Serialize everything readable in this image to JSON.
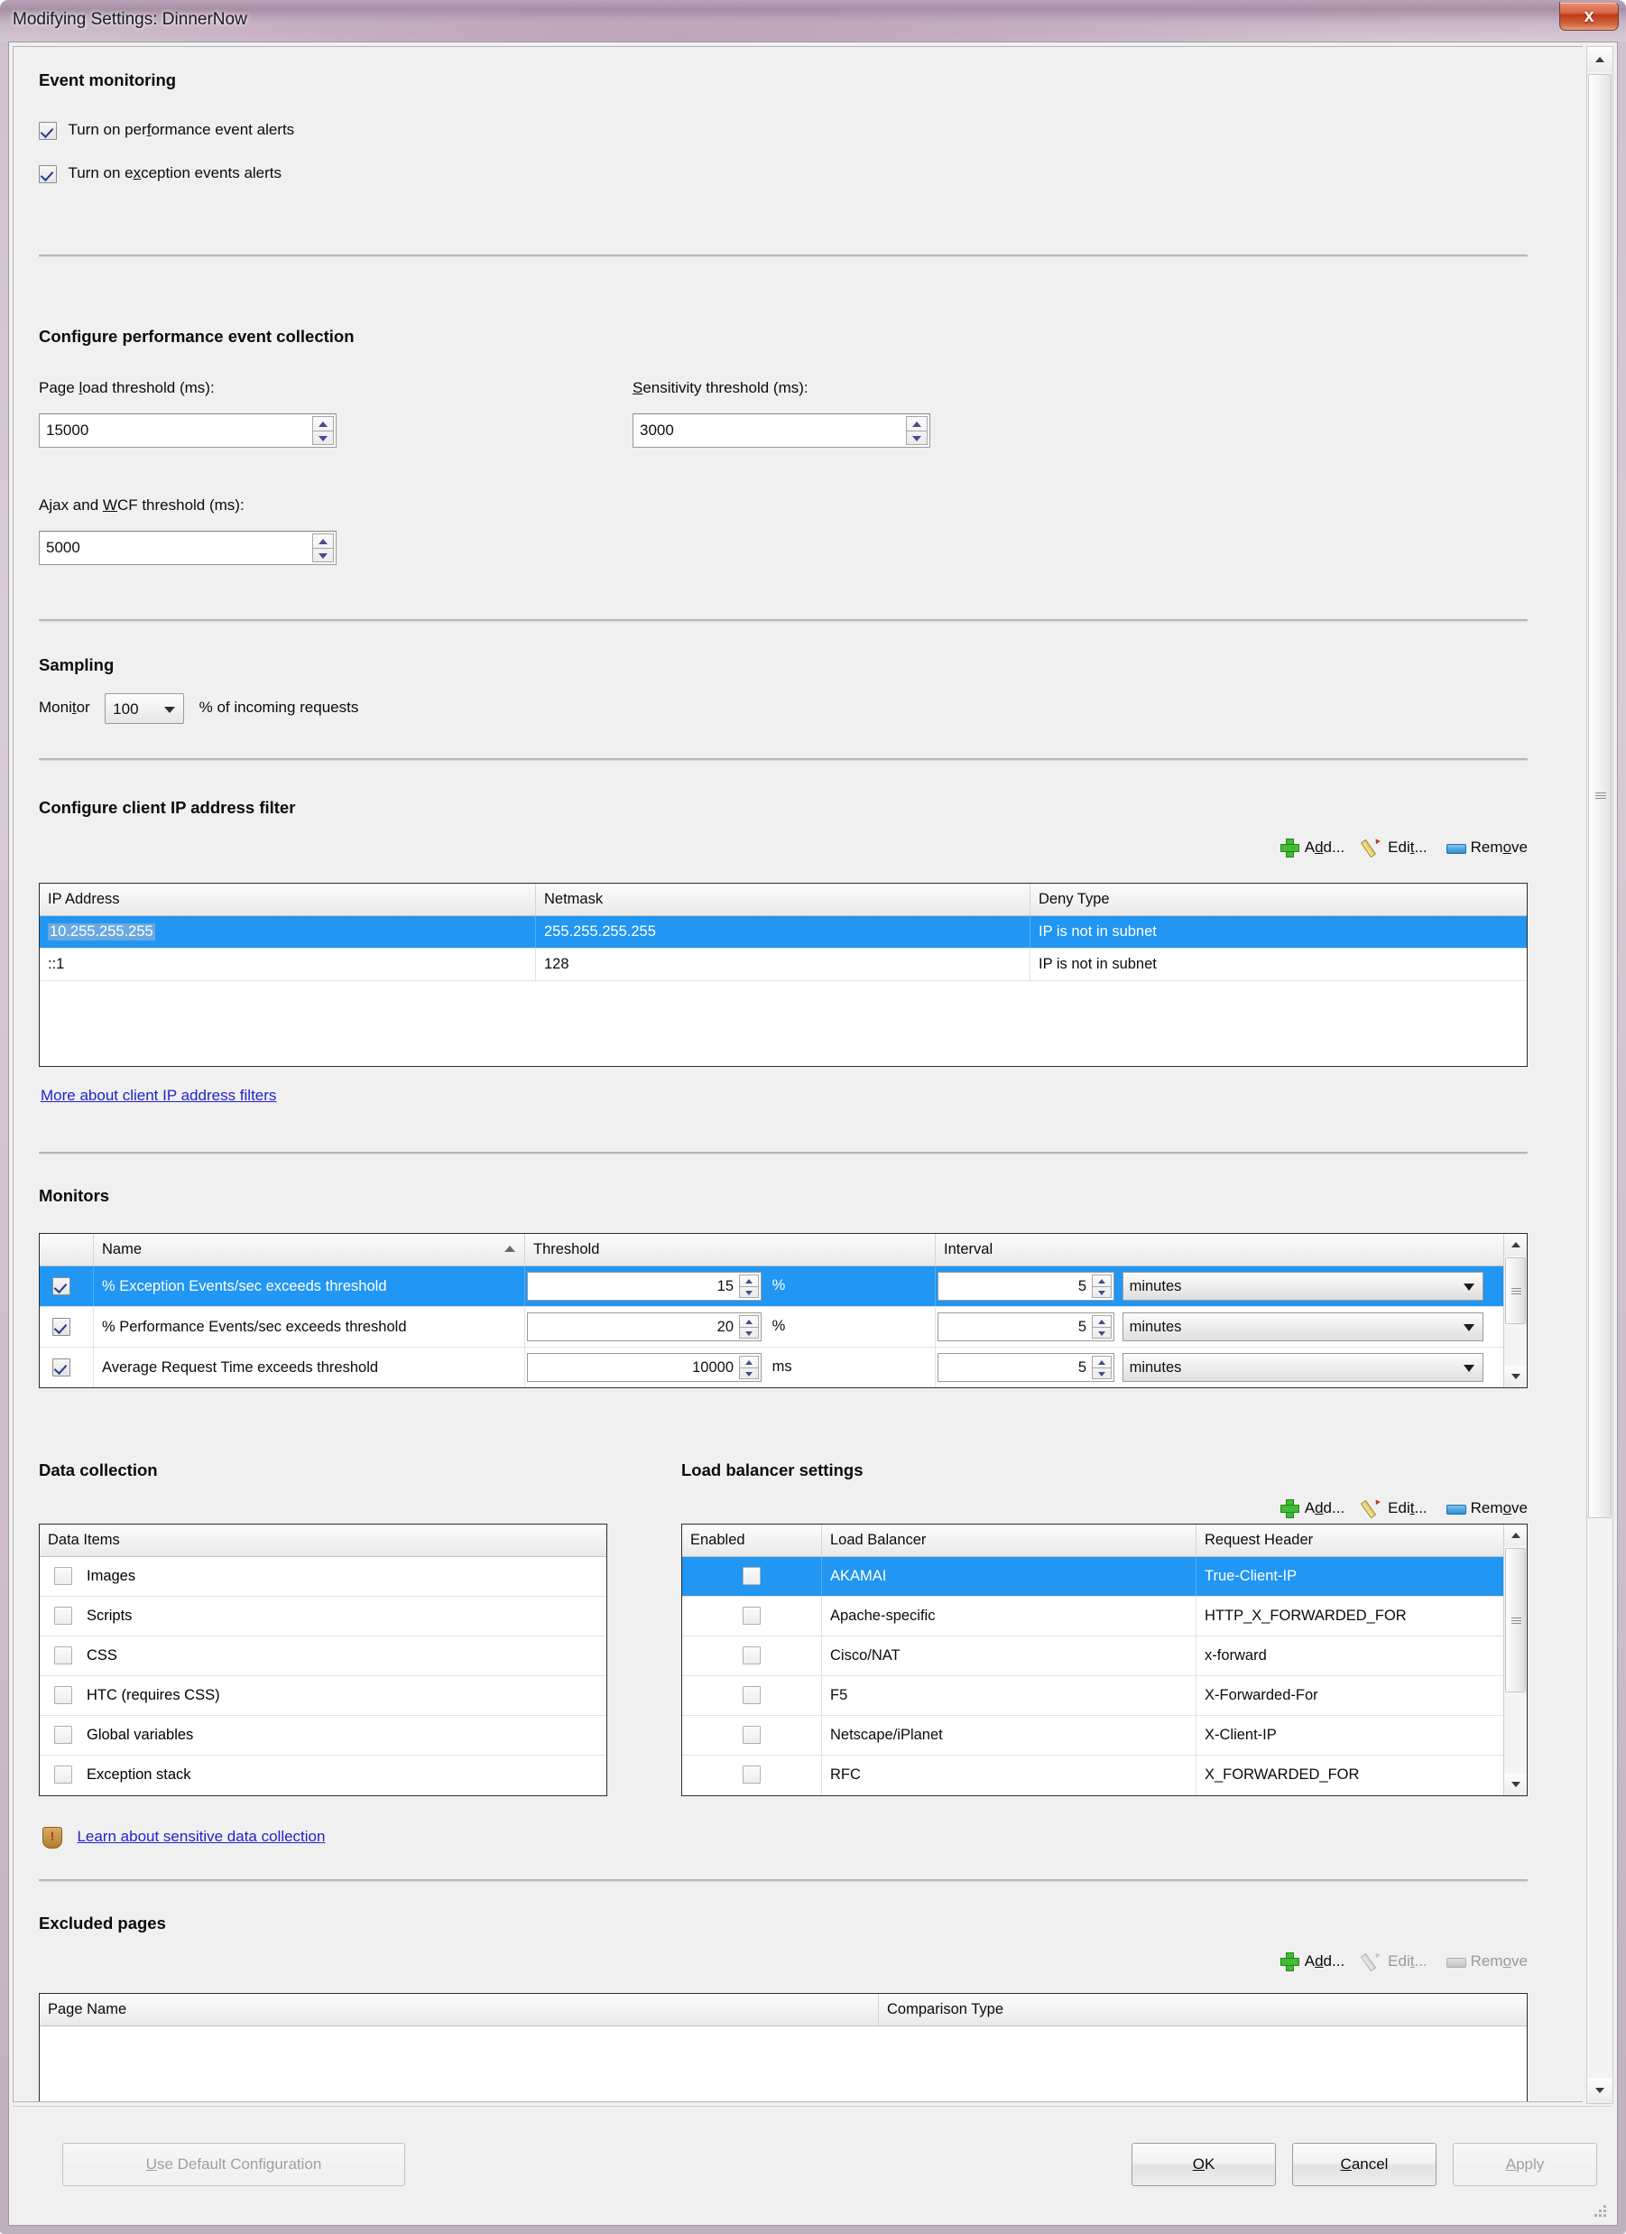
{
  "window": {
    "title": "Modifying Settings: DinnerNow",
    "close_label": "x"
  },
  "event_monitoring": {
    "heading": "Event monitoring",
    "checkboxes": [
      {
        "label_pre": "Turn on per",
        "accel": "f",
        "label_post": "ormance event alerts",
        "checked": true
      },
      {
        "label_pre": "Turn on e",
        "accel": "x",
        "label_post": "ception events alerts",
        "checked": true
      }
    ]
  },
  "performance_collection": {
    "heading": "Configure performance event collection",
    "fields": [
      {
        "label_pre": "Page ",
        "accel": "l",
        "label_post": "oad threshold (ms):",
        "value": "15000"
      },
      {
        "label_pre": "",
        "accel": "S",
        "label_post": "ensitivity threshold (ms):",
        "value": "3000"
      },
      {
        "label_pre": "Ajax and ",
        "accel": "W",
        "label_post": "CF threshold (ms):",
        "value": "5000"
      }
    ]
  },
  "sampling": {
    "heading": "Sampling",
    "label_pre": "Moni",
    "accel": "t",
    "label_post": "or",
    "selected": "100",
    "suffix": "% of incoming requests"
  },
  "ip_filter": {
    "heading": "Configure client IP address filter",
    "toolbar": [
      {
        "name": "add",
        "label_pre": "A",
        "accel": "d",
        "label_post": "d...",
        "icon": "plus-icon",
        "disabled": false
      },
      {
        "name": "edit",
        "label_pre": "Edi",
        "accel": "t",
        "label_post": "...",
        "icon": "pencil-icon",
        "disabled": false
      },
      {
        "name": "remove",
        "label_pre": "Rem",
        "accel": "o",
        "label_post": "ve",
        "icon": "remove-icon",
        "disabled": false
      }
    ],
    "columns": [
      "IP Address",
      "Netmask",
      "Deny Type"
    ],
    "rows": [
      {
        "cells": [
          "10.255.255.255",
          "255.255.255.255",
          "IP is not in subnet"
        ],
        "selected": true,
        "focus_cell": 0
      },
      {
        "cells": [
          "::1",
          "128",
          "IP is not in subnet"
        ],
        "selected": false,
        "focus_cell": -1
      }
    ],
    "link": "More about client IP address filters"
  },
  "monitors": {
    "heading": "Monitors",
    "columns": [
      "",
      "Name",
      "Threshold",
      "Interval"
    ],
    "sort_column": "Name",
    "rows": [
      {
        "checked": true,
        "name": "% Exception Events/sec exceeds threshold",
        "threshold": "15",
        "unit": "%",
        "interval": "5",
        "interval_unit": "minutes",
        "selected": true
      },
      {
        "checked": true,
        "name": "% Performance Events/sec exceeds threshold",
        "threshold": "20",
        "unit": "%",
        "interval": "5",
        "interval_unit": "minutes",
        "selected": false
      },
      {
        "checked": true,
        "name": "Average Request Time exceeds threshold",
        "threshold": "10000",
        "unit": "ms",
        "interval": "5",
        "interval_unit": "minutes",
        "selected": false
      }
    ]
  },
  "data_collection": {
    "heading": "Data collection",
    "column": "Data Items",
    "items": [
      {
        "label": "Images",
        "checked": false
      },
      {
        "label": "Scripts",
        "checked": false
      },
      {
        "label": "CSS",
        "checked": false
      },
      {
        "label": "HTC (requires CSS)",
        "checked": false
      },
      {
        "label": "Global variables",
        "checked": false
      },
      {
        "label": "Exception stack",
        "checked": false
      }
    ],
    "link": "Learn about sensitive data collection",
    "link_icon": "shield-warning-icon"
  },
  "load_balancer": {
    "heading": "Load balancer settings",
    "toolbar": [
      {
        "name": "add",
        "label_pre": "A",
        "accel": "d",
        "label_post": "d...",
        "icon": "plus-icon",
        "disabled": false
      },
      {
        "name": "edit",
        "label_pre": "Edi",
        "accel": "t",
        "label_post": "...",
        "icon": "pencil-icon",
        "disabled": false
      },
      {
        "name": "remove",
        "label_pre": "Rem",
        "accel": "o",
        "label_post": "ve",
        "icon": "remove-icon",
        "disabled": false
      }
    ],
    "columns": [
      "Enabled",
      "Load Balancer",
      "Request Header"
    ],
    "rows": [
      {
        "checked": false,
        "name": "AKAMAI",
        "header": "True-Client-IP",
        "selected": true
      },
      {
        "checked": false,
        "name": "Apache-specific",
        "header": "HTTP_X_FORWARDED_FOR",
        "selected": false
      },
      {
        "checked": false,
        "name": "Cisco/NAT",
        "header": "x-forward",
        "selected": false
      },
      {
        "checked": false,
        "name": "F5",
        "header": "X-Forwarded-For",
        "selected": false
      },
      {
        "checked": false,
        "name": "Netscape/iPlanet",
        "header": "X-Client-IP",
        "selected": false
      },
      {
        "checked": false,
        "name": "RFC",
        "header": "X_FORWARDED_FOR",
        "selected": false
      }
    ]
  },
  "excluded_pages": {
    "heading": "Excluded pages",
    "toolbar": [
      {
        "name": "add",
        "label_pre": "A",
        "accel": "d",
        "label_post": "d...",
        "icon": "plus-icon",
        "disabled": false
      },
      {
        "name": "edit",
        "label_pre": "Edi",
        "accel": "t",
        "label_post": "...",
        "icon": "pencil-icon",
        "disabled": true
      },
      {
        "name": "remove",
        "label_pre": "Rem",
        "accel": "o",
        "label_post": "ve",
        "icon": "remove-icon",
        "disabled": true
      }
    ],
    "columns": [
      "Page Name",
      "Comparison Type"
    ],
    "rows": []
  },
  "footer": {
    "use_default": {
      "label_pre": "",
      "accel": "U",
      "label_post": "se Default Configuration",
      "disabled": true
    },
    "ok": {
      "label_pre": "",
      "accel": "O",
      "label_post": "K",
      "disabled": false
    },
    "cancel": {
      "label_pre": "",
      "accel": "C",
      "label_post": "ancel",
      "disabled": false
    },
    "apply": {
      "label_pre": "",
      "accel": "A",
      "label_post": "pply",
      "disabled": true
    }
  }
}
